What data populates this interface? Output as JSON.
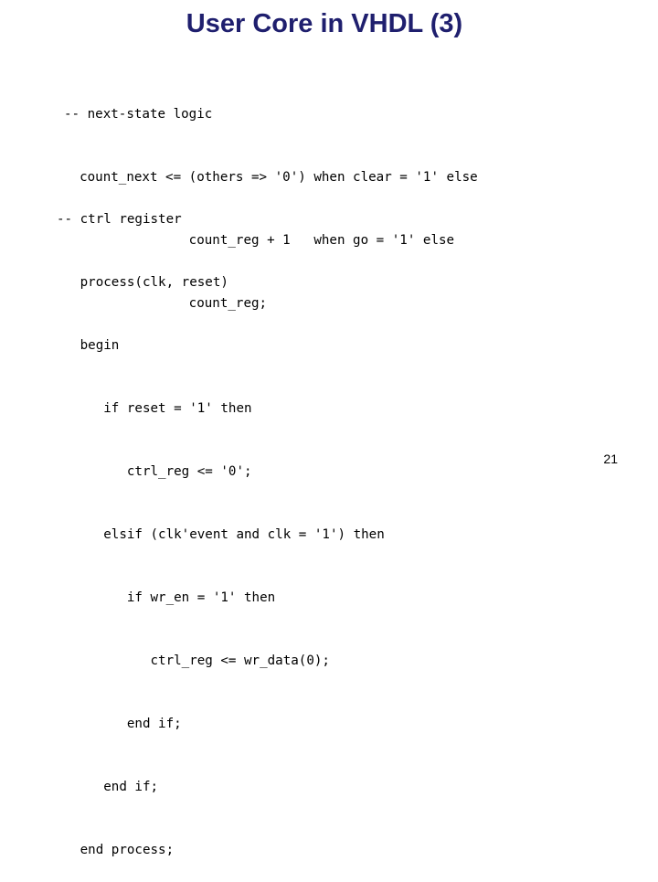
{
  "slide": {
    "title": "User Core in VHDL (3)",
    "page_number": "21"
  },
  "code_blocks": [
    {
      "name": "next-state-logic",
      "lines": [
        "-- next-state logic",
        "  count_next <= (others => '0') when clear = '1' else",
        "                count_reg + 1   when go = '1' else",
        "                count_reg;"
      ]
    },
    {
      "name": "ctrl-register",
      "lines": [
        "-- ctrl register",
        "   process(clk, reset)",
        "   begin",
        "      if reset = '1' then",
        "         ctrl_reg <= '0';",
        "      elsif (clk'event and clk = '1') then",
        "         if wr_en = '1' then",
        "            ctrl_reg <= wr_data(0);",
        "         end if;",
        "      end if;",
        "   end process;"
      ]
    }
  ]
}
